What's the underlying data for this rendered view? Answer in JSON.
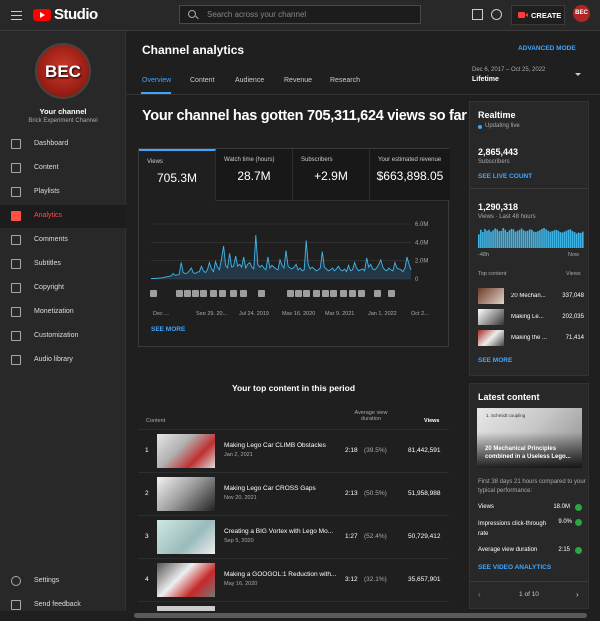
{
  "topbar": {
    "studio": "Studio",
    "search_placeholder": "Search across your channel",
    "create_label": "CREATE",
    "avatar_text": "BEC"
  },
  "sidebar": {
    "logo_text": "BEC",
    "your_channel": "Your channel",
    "channel_name": "Brick Experiment Channel",
    "items": [
      {
        "label": "Dashboard",
        "icon": "dashboard-icon"
      },
      {
        "label": "Content",
        "icon": "content-icon"
      },
      {
        "label": "Playlists",
        "icon": "playlists-icon"
      },
      {
        "label": "Analytics",
        "icon": "analytics-icon",
        "active": true
      },
      {
        "label": "Comments",
        "icon": "comments-icon"
      },
      {
        "label": "Subtitles",
        "icon": "subtitles-icon"
      },
      {
        "label": "Copyright",
        "icon": "copyright-icon"
      },
      {
        "label": "Monetization",
        "icon": "monetization-icon"
      },
      {
        "label": "Customization",
        "icon": "customization-icon"
      },
      {
        "label": "Audio library",
        "icon": "audio-library-icon"
      }
    ],
    "bottom": [
      {
        "label": "Settings",
        "icon": "gear-icon"
      },
      {
        "label": "Send feedback",
        "icon": "feedback-icon"
      }
    ]
  },
  "main": {
    "title": "Channel analytics",
    "advanced_mode": "ADVANCED MODE",
    "date_range": "Dec 6, 2017 – Oct 25, 2022",
    "period": "Lifetime",
    "tabs": [
      "Overview",
      "Content",
      "Audience",
      "Revenue",
      "Research"
    ],
    "headline": "Your channel has gotten 705,311,624 views so far",
    "kpis": [
      {
        "label": "Views",
        "value": "705.3M"
      },
      {
        "label": "Watch time (hours)",
        "value": "28.7M"
      },
      {
        "label": "Subscribers",
        "value": "+2.9M"
      },
      {
        "label": "Your estimated revenue",
        "value": "$663,898.05"
      }
    ],
    "see_more": "SEE MORE",
    "top_content": {
      "title": "Your top content in this period",
      "col_content": "Content",
      "col_avg": "Average view duration",
      "col_views": "Views",
      "rows": [
        {
          "rank": "1",
          "title": "Making Lego Car CLIMB Obstacles",
          "date": "Jan 2, 2021",
          "duration": "2:18",
          "pct": "(39.5%)",
          "views": "81,442,591"
        },
        {
          "rank": "2",
          "title": "Making Lego Car CROSS Gaps",
          "date": "Nov 20, 2021",
          "duration": "2:13",
          "pct": "(50.5%)",
          "views": "51,958,988"
        },
        {
          "rank": "3",
          "title": "Creating a BIG Vortex with Lego Mo...",
          "date": "Sep 5, 2020",
          "duration": "1:27",
          "pct": "(52.4%)",
          "views": "50,729,412"
        },
        {
          "rank": "4",
          "title": "Making a GOOGOL:1 Reduction with...",
          "date": "May 16, 2020",
          "duration": "3:12",
          "pct": "(32.1%)",
          "views": "35,657,901"
        }
      ]
    }
  },
  "chart_data": {
    "type": "line",
    "title": "",
    "x_labels": [
      "Dec ...",
      "Sep 29, 20...",
      "Jul 24, 2019",
      "May 16, 2020",
      "Mar 9, 2021",
      "Jan 1, 2022",
      "Oct 2..."
    ],
    "y_ticks": [
      "6.0M",
      "4.0M",
      "2.0M",
      "0"
    ],
    "ylim": [
      0,
      6000000
    ],
    "grid": true,
    "series": [
      {
        "values": [
          0.05,
          0.05,
          0.06,
          0.08,
          0.1,
          0.12,
          0.15,
          0.2,
          0.25,
          0.3,
          0.35,
          0.6,
          0.4,
          0.45,
          0.5,
          1.8,
          0.7,
          0.6,
          0.65,
          0.9,
          1.2,
          0.7,
          0.6,
          0.75,
          0.8,
          1.4,
          0.9,
          0.7,
          1.0,
          1.8,
          1.1,
          0.8,
          1.9,
          1.3,
          1.0,
          2.2,
          3.6,
          1.5,
          1.2,
          2.8,
          1.3,
          1.4,
          2.5,
          1.4,
          1.6,
          1.3,
          2.4,
          1.2,
          1.6,
          1.8,
          1.3,
          1.1,
          4.8,
          1.6,
          1.3,
          1.5,
          1.2,
          1.0,
          2.4,
          1.2,
          1.5,
          1.3,
          1.1,
          1.0,
          2.1,
          1.5,
          1.2,
          3.1,
          1.4,
          1.2,
          1.1,
          1.3,
          1.6,
          1.0,
          1.2,
          0.9,
          1.0,
          4.2,
          1.6,
          1.1,
          1.3,
          1.1,
          0.9,
          1.0,
          1.2,
          3.0,
          1.3,
          1.1,
          0.9,
          1.0,
          1.2,
          0.9,
          1.1,
          1.4,
          1.0,
          0.9,
          1.1,
          0.8,
          1.5,
          0.9,
          1.0,
          1.8,
          1.2,
          0.9,
          1.0,
          1.1,
          0.9,
          2.3,
          1.3,
          1.6,
          1.1,
          1.0,
          1.2,
          1.6,
          2.1,
          1.3,
          1.0,
          0.9,
          1.2,
          1.0,
          0.9,
          1.8,
          1.2,
          1.1,
          1.0,
          0.8,
          1.2,
          2.4,
          1.6,
          1.0
        ]
      }
    ]
  },
  "realtime": {
    "title": "Realtime",
    "status": "Updating live",
    "subs_value": "2,865,443",
    "subs_label": "Subscribers",
    "see_live": "SEE LIVE COUNT",
    "views_value": "1,290,318",
    "views_label": "Views · Last 48 hours",
    "left_label": "-48h",
    "right_label": "Now",
    "bars": [
      3,
      4,
      3.5,
      4.2,
      3.8,
      4,
      3.6,
      3.9,
      4.3,
      4.1,
      3.7,
      3.8,
      4.4,
      4.0,
      3.5,
      3.9,
      4.2,
      4.1,
      3.6,
      3.8,
      4.0,
      4.3,
      3.9,
      3.7,
      3.8,
      4.1,
      4.0,
      3.6,
      3.5,
      3.7,
      3.9,
      4.2,
      4.4,
      4.1,
      3.8,
      3.6,
      3.7,
      3.9,
      4.0,
      3.8,
      3.5,
      3.4,
      3.6,
      3.8,
      4.0,
      4.1,
      3.7,
      3.5,
      3.2,
      3.4,
      3.3,
      3.6
    ],
    "top_content_label": "Top content",
    "views_col": "Views",
    "items": [
      {
        "title": "20 Mechan...",
        "views": "337,048"
      },
      {
        "title": "Making Le...",
        "views": "202,035"
      },
      {
        "title": "Making the ...",
        "views": "71,414"
      }
    ],
    "see_more": "SEE MORE"
  },
  "latest": {
    "title": "Latest content",
    "thumb_caption": "1. Schmidt coupling",
    "video_title": "20 Mechanical Principles combined in a Useless Lego...",
    "compare_text": "First 38 days 21 hours compared to your typical performance:",
    "metrics": [
      {
        "label": "Views",
        "value": "18.0M"
      },
      {
        "label": "Impressions click-through rate",
        "value": "9.0%"
      },
      {
        "label": "Average view duration",
        "value": "2:15"
      }
    ],
    "see_video": "SEE VIDEO ANALYTICS",
    "pager": "1 of 10"
  },
  "colors": {
    "accent": "#3ea6ff",
    "brand_red": "#ff0000",
    "success": "#2ba640"
  }
}
